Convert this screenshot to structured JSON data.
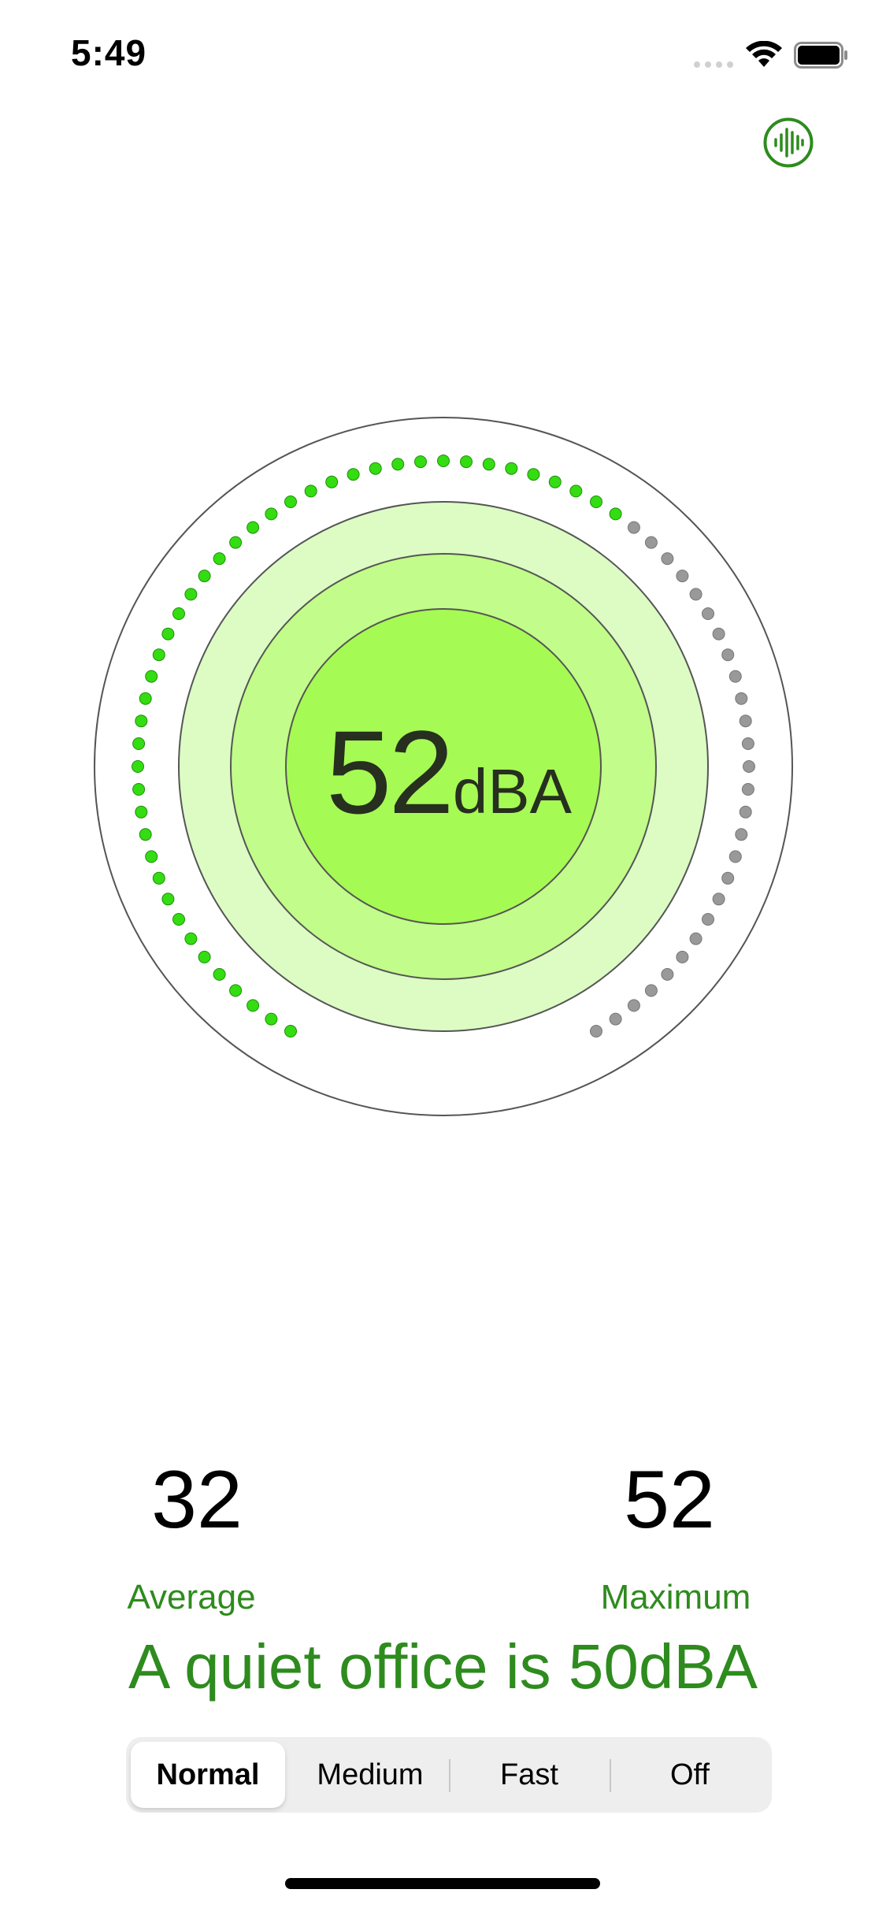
{
  "status_bar": {
    "time": "5:49"
  },
  "toolbar": {
    "meter_icon": "waveform-circle-icon"
  },
  "meter": {
    "value": "52",
    "unit": "dBA",
    "level_fraction": 0.52,
    "active_color": "#33dd11",
    "inactive_color": "#999999",
    "ring_colors": [
      "#dcfcc4",
      "#c2fc8a",
      "#a6fa54"
    ]
  },
  "stats": {
    "average_value": "32",
    "average_label": "Average",
    "maximum_value": "52",
    "maximum_label": "Maximum"
  },
  "comparison_text": "A quiet office is 50dBA",
  "speed_control": {
    "options": [
      "Normal",
      "Medium",
      "Fast",
      "Off"
    ],
    "selected": "Normal"
  },
  "colors": {
    "accent": "#2e8b1e"
  }
}
